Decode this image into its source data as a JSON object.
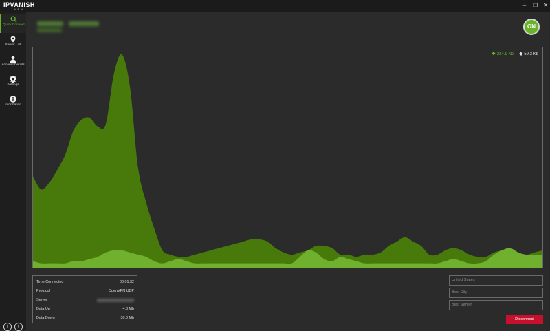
{
  "app": {
    "logo_line1": "IPVANISH",
    "logo_line2": "VPN",
    "window_buttons": [
      "minimize",
      "restore",
      "close"
    ]
  },
  "sidebar": {
    "items": [
      {
        "label": "Quick Connect",
        "icon": "search-icon",
        "active": true
      },
      {
        "label": "Server List",
        "icon": "location-pin-icon",
        "active": false
      },
      {
        "label": "Account Details",
        "icon": "user-icon",
        "active": false
      },
      {
        "label": "Settings",
        "icon": "gear-icon",
        "active": false
      },
      {
        "label": "Information",
        "icon": "info-icon",
        "active": false
      }
    ],
    "social": [
      {
        "icon": "facebook-icon",
        "glyph": "f"
      },
      {
        "icon": "twitter-icon",
        "glyph": "t"
      }
    ]
  },
  "status": {
    "toggle_label": "ON",
    "accent_color": "#69b32a"
  },
  "speed": {
    "down": "224.9 Kb",
    "up": "59.3 Kb"
  },
  "stats": [
    {
      "key": "Time Connected",
      "value": "00:01:32"
    },
    {
      "key": "Protocol",
      "value": "OpenVPN UDP"
    },
    {
      "key": "Server",
      "value": ""
    },
    {
      "key": "Data Up",
      "value": "4.3 Mb"
    },
    {
      "key": "Data Down",
      "value": "30.0 Mb"
    }
  ],
  "location": {
    "country_placeholder": "United States",
    "city_placeholder": "Best City",
    "server_placeholder": "Best Server"
  },
  "disconnect_label": "Disconnect",
  "chart_data": {
    "type": "area",
    "series": [
      {
        "color": "#477a0b",
        "values": [
          0.42,
          0.36,
          0.39,
          0.45,
          0.52,
          0.63,
          0.68,
          0.69,
          0.65,
          0.66,
          0.89,
          0.98,
          0.83,
          0.46,
          0.3,
          0.18,
          0.08,
          0.06,
          0.05,
          0.05,
          0.06,
          0.07,
          0.08,
          0.09,
          0.1,
          0.11,
          0.12,
          0.13,
          0.13,
          0.12,
          0.09,
          0.07,
          0.06,
          0.07,
          0.08,
          0.1,
          0.1,
          0.09,
          0.06,
          0.06,
          0.05,
          0.06,
          0.06,
          0.07,
          0.1,
          0.12,
          0.14,
          0.12,
          0.1,
          0.06,
          0.06,
          0.08,
          0.09,
          0.08,
          0.06,
          0.05,
          0.05,
          0.07,
          0.08,
          0.09,
          0.07,
          0.06,
          0.07,
          0.08
        ]
      },
      {
        "color": "#6fb02e",
        "values": [
          0.03,
          0.02,
          0.02,
          0.02,
          0.02,
          0.03,
          0.03,
          0.04,
          0.05,
          0.07,
          0.08,
          0.08,
          0.07,
          0.06,
          0.05,
          0.03,
          0.02,
          0.03,
          0.04,
          0.03,
          0.02,
          0.02,
          0.02,
          0.02,
          0.02,
          0.02,
          0.02,
          0.02,
          0.02,
          0.02,
          0.02,
          0.02,
          0.02,
          0.05,
          0.08,
          0.07,
          0.04,
          0.03,
          0.05,
          0.04,
          0.03,
          0.02,
          0.02,
          0.02,
          0.02,
          0.02,
          0.02,
          0.02,
          0.02,
          0.02,
          0.02,
          0.03,
          0.04,
          0.03,
          0.02,
          0.02,
          0.03,
          0.06,
          0.08,
          0.09,
          0.07,
          0.06,
          0.06,
          0.06
        ]
      }
    ],
    "ylim": [
      0,
      1
    ],
    "grid": false
  }
}
